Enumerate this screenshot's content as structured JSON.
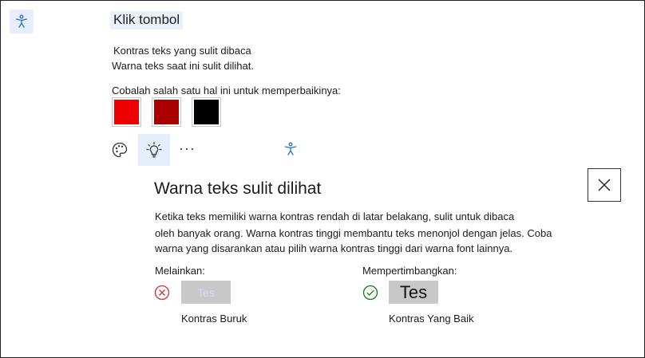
{
  "header": {
    "title": "Klik tombol"
  },
  "issue": {
    "title": "Kontras teks yang sulit dibaca",
    "description": "Warna teks saat ini sulit dilihat.",
    "fix_prompt": "Cobalah salah satu hal ini untuk memperbaikinya:"
  },
  "swatches": [
    {
      "color": "#ee0000"
    },
    {
      "color": "#aa0000"
    },
    {
      "color": "#000000"
    }
  ],
  "toolbar": {
    "more_label": "···"
  },
  "panel": {
    "title": "Warna teks sulit dilihat",
    "body": [
      "Ketika teks memiliki warna kontras rendah di latar belakang, sulit untuk dibaca",
      "oleh banyak orang. Warna kontras tinggi membantu teks menonjol dengan jelas. Coba",
      "warna yang disarankan atau pilih warna kontras tinggi dari warna font lainnya."
    ],
    "bad": {
      "label": "Melainkan:",
      "sample_text": "Tes",
      "caption": "Kontras Buruk",
      "text_color": "#d6dcf0",
      "bg_color": "#c8c8c8"
    },
    "good": {
      "label": "Mempertimbangkan:",
      "sample_text": "Tes",
      "caption": "Kontras Yang Baik",
      "text_color": "#111111",
      "bg_color": "#c8c8c8"
    }
  },
  "colors": {
    "accent": "#2b6cc4",
    "error": "#d13438",
    "success": "#107c10"
  }
}
